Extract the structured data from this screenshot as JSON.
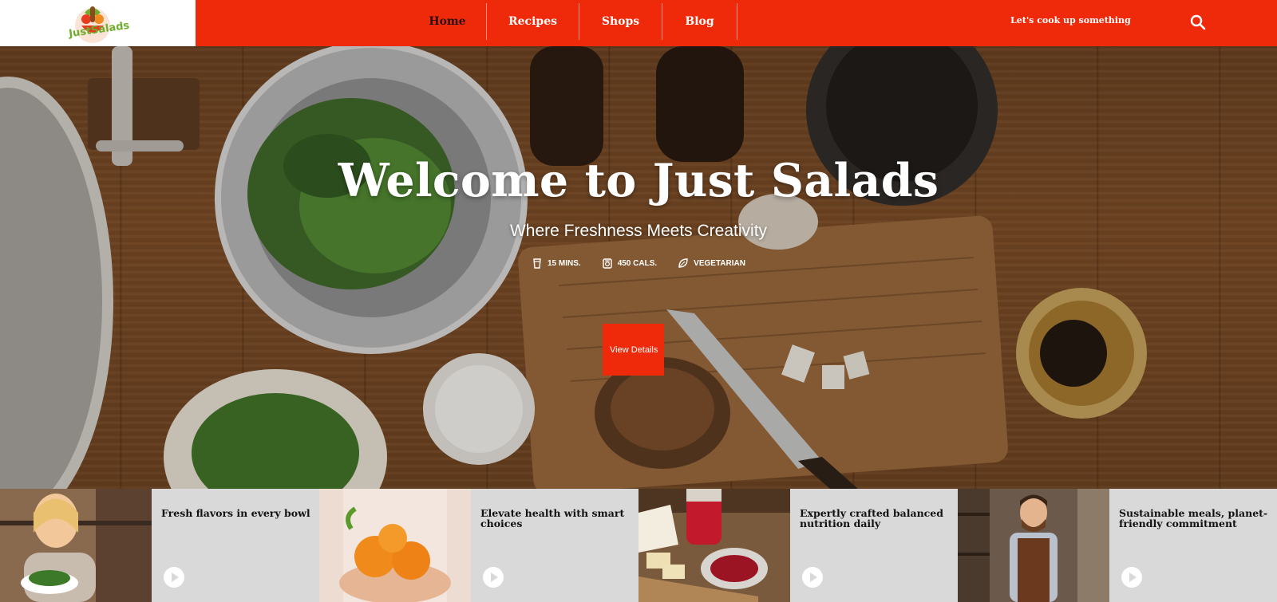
{
  "header": {
    "logo_text": "JustSalads",
    "nav": [
      {
        "label": "Home",
        "active": true
      },
      {
        "label": "Recipes",
        "active": false
      },
      {
        "label": "Shops",
        "active": false
      },
      {
        "label": "Blog",
        "active": false
      }
    ],
    "tagline": "Let's cook up something",
    "search_icon": "search-icon"
  },
  "hero": {
    "title": "Welcome to Just Salads",
    "subtitle": "Where Freshness Meets Creativity",
    "meta": [
      {
        "icon": "cup-icon",
        "label": "15 MINS."
      },
      {
        "icon": "calories-icon",
        "label": "450 CALS."
      },
      {
        "icon": "leaf-icon",
        "label": "VEGETARIAN"
      }
    ],
    "cta_label": "View Details"
  },
  "features": [
    {
      "title": "Fresh flavors in every bowl",
      "image": "woman-with-salad"
    },
    {
      "title": "Elevate health with smart choices",
      "image": "hands-holding-oranges"
    },
    {
      "title": "Expertly crafted balanced nutrition daily",
      "image": "jam-and-cheese-board"
    },
    {
      "title": "Sustainable meals, planet-friendly commitment",
      "image": "chef-in-apron"
    }
  ],
  "colors": {
    "brand_red": "#ee2a0b",
    "card_bg": "#d9d9d9",
    "logo_green": "#6fae2c"
  }
}
